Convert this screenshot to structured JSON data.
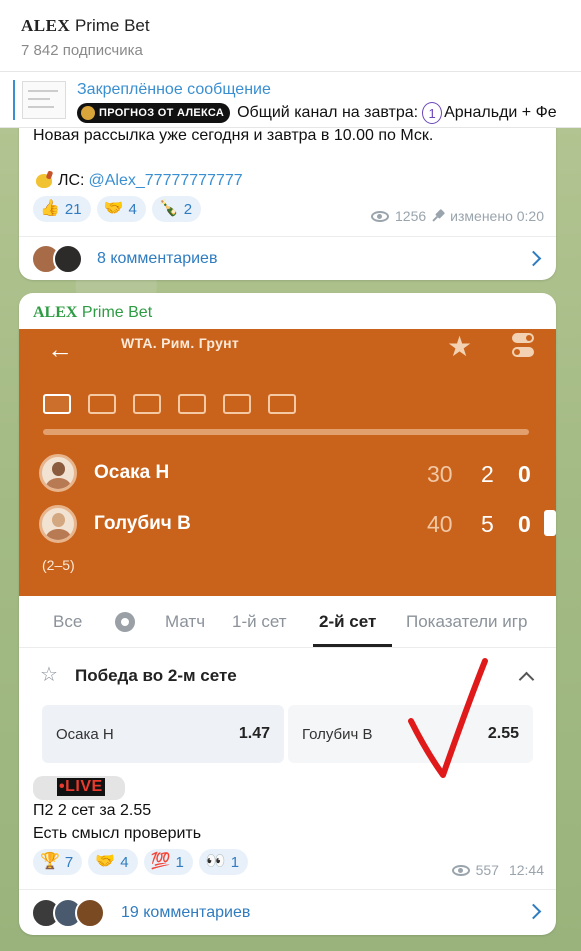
{
  "header": {
    "channel_name_bold": "ALEX",
    "channel_name_rest": "Prime Bet",
    "subscribers": "7 842 подписчика"
  },
  "pinned": {
    "title": "Закреплённое сообщение",
    "badge": "ПРОГНОЗ ОТ АЛЕКСА",
    "text_start": "Общий канал на завтра:",
    "number": "1",
    "text_end": "Арнальди + Фе"
  },
  "post1": {
    "line1": "Новая рассылка  уже сегодня и завтра в 10.00 по Мск.",
    "ls_label": "ЛС:",
    "ls_link": "@Alex_77777777777",
    "reactions": [
      {
        "emoji": "👍",
        "count": "21"
      },
      {
        "emoji": "🤝",
        "count": "4"
      },
      {
        "emoji": "🍾",
        "count": "2"
      }
    ],
    "views": "1256",
    "edited": "изменено 0:20",
    "comments": "8 комментариев"
  },
  "post2": {
    "author_bold": "ALEX",
    "author_rest": "Prime Bet",
    "screenshot": {
      "back": "←",
      "league": "WTA. Рим. Грунт",
      "players": [
        {
          "name": "Осака Н",
          "points": "30",
          "games": "2",
          "sets": "0"
        },
        {
          "name": "Голубич В",
          "points": "40",
          "games": "5",
          "sets": "0"
        }
      ],
      "set_info": "(2–5)",
      "tabs": [
        "Все",
        "Матч",
        "1-й сет",
        "2-й сет",
        "Показатели игр"
      ],
      "active_tab": "2-й сет",
      "market": "Победа во 2-м сете",
      "odds": [
        {
          "name": "Осака Н",
          "value": "1.47"
        },
        {
          "name": "Голубич В",
          "value": "2.55"
        }
      ]
    },
    "live": "•LIVE",
    "bet": "П2 2 сет за 2.55",
    "note": "Есть смысл проверить",
    "reactions": [
      {
        "emoji": "🏆",
        "count": "7"
      },
      {
        "emoji": "🤝",
        "count": "4"
      },
      {
        "emoji": "💯",
        "count": "1"
      },
      {
        "emoji": "👀",
        "count": "1"
      }
    ],
    "views": "557",
    "time": "12:44",
    "comments": "19 комментариев"
  },
  "colors": {
    "accent": "#3a8fd1",
    "orange": "#c9631b",
    "author_green": "#2e9c43",
    "checkmark_red": "#e01a1a"
  }
}
